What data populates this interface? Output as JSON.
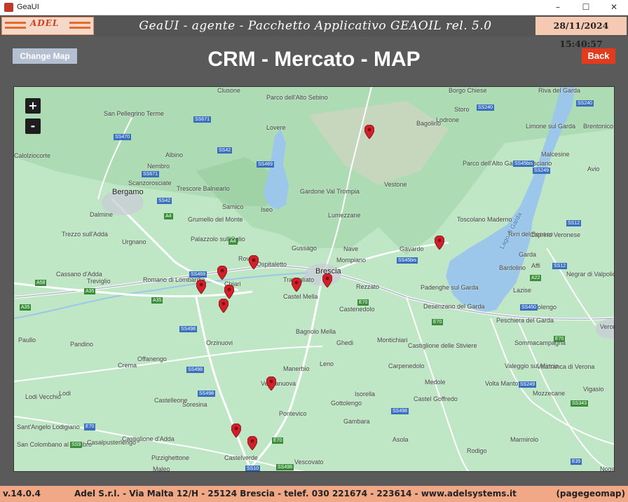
{
  "window": {
    "title": "GeaUI",
    "controls": [
      "–",
      "☐",
      "✕"
    ]
  },
  "header": {
    "logo_text": "ADEL",
    "app_title": "GeaUI - agente - Pacchetto Applicativo GEAOIL rel. 5.0",
    "datetime": "28/11/2024 15:40:57"
  },
  "page": {
    "change_map_label": "Change Map",
    "title": "CRM - Mercato - MAP",
    "back_label": "Back"
  },
  "map": {
    "zoom_in": "+",
    "zoom_out": "-",
    "lake_label": "Lago di Garda",
    "places": [
      {
        "name": "Clusone",
        "big": false
      },
      {
        "name": "Parco dell'Alto Sebino",
        "big": false
      },
      {
        "name": "Borgo Chiese",
        "big": false
      },
      {
        "name": "Riva del Garda",
        "big": false
      },
      {
        "name": "San Pellegrino Terme",
        "big": false
      },
      {
        "name": "Storo",
        "big": false
      },
      {
        "name": "Lovere",
        "big": false
      },
      {
        "name": "Bagolino",
        "big": false
      },
      {
        "name": "Lodrone",
        "big": false
      },
      {
        "name": "Limone sul Garda",
        "big": false
      },
      {
        "name": "Brentonico",
        "big": false
      },
      {
        "name": "Calolziocorte",
        "big": false
      },
      {
        "name": "Albino",
        "big": false
      },
      {
        "name": "Malcesine",
        "big": false
      },
      {
        "name": "Nembro",
        "big": false
      },
      {
        "name": "Parco dell'Alto Garda Bresciano",
        "big": false
      },
      {
        "name": "Avio",
        "big": false
      },
      {
        "name": "Scanzorosciate",
        "big": false
      },
      {
        "name": "Bergamo",
        "big": true
      },
      {
        "name": "Trescore Balneario",
        "big": false
      },
      {
        "name": "Gardone Val Trompia",
        "big": false
      },
      {
        "name": "Vestone",
        "big": false
      },
      {
        "name": "Sarnico",
        "big": false
      },
      {
        "name": "Iseo",
        "big": false
      },
      {
        "name": "Dalmine",
        "big": false
      },
      {
        "name": "Grumello del Monte",
        "big": false
      },
      {
        "name": "Lumezzane",
        "big": false
      },
      {
        "name": "Toscolano Maderno",
        "big": false
      },
      {
        "name": "Trezzo sull'Adda",
        "big": false
      },
      {
        "name": "Urgnano",
        "big": false
      },
      {
        "name": "Palazzolo sull'Oglio",
        "big": false
      },
      {
        "name": "Torri del Benaco",
        "big": false
      },
      {
        "name": "Caprino Veronese",
        "big": false
      },
      {
        "name": "Gussago",
        "big": false
      },
      {
        "name": "Nave",
        "big": false
      },
      {
        "name": "Gavardo",
        "big": false
      },
      {
        "name": "Garda",
        "big": false
      },
      {
        "name": "Mompiano",
        "big": false
      },
      {
        "name": "Rovato",
        "big": false
      },
      {
        "name": "Ospitaletto",
        "big": false
      },
      {
        "name": "Brescia",
        "big": true
      },
      {
        "name": "Bardolino",
        "big": false
      },
      {
        "name": "Affi",
        "big": false
      },
      {
        "name": "Cassano d'Adda",
        "big": false
      },
      {
        "name": "Treviglio",
        "big": false
      },
      {
        "name": "Romano di Lombardia",
        "big": false
      },
      {
        "name": "Chiari",
        "big": false
      },
      {
        "name": "Travagliato",
        "big": false
      },
      {
        "name": "Rezzato",
        "big": false
      },
      {
        "name": "Padenghe sul Garda",
        "big": false
      },
      {
        "name": "Lazise",
        "big": false
      },
      {
        "name": "Negrar di Valpolicella",
        "big": false
      },
      {
        "name": "Castel Mella",
        "big": false
      },
      {
        "name": "Castenedolo",
        "big": false
      },
      {
        "name": "Desenzano del Garda",
        "big": false
      },
      {
        "name": "Bussolengo",
        "big": false
      },
      {
        "name": "Bagnolo Mella",
        "big": false
      },
      {
        "name": "Peschiera del Garda",
        "big": false
      },
      {
        "name": "Verona",
        "big": false
      },
      {
        "name": "Paullo",
        "big": false
      },
      {
        "name": "Pandino",
        "big": false
      },
      {
        "name": "Orzinuovi",
        "big": false
      },
      {
        "name": "Montichiari",
        "big": false
      },
      {
        "name": "Ghedi",
        "big": false
      },
      {
        "name": "Castiglione delle Stiviere",
        "big": false
      },
      {
        "name": "Sommacampagna",
        "big": false
      },
      {
        "name": "Offanengo",
        "big": false
      },
      {
        "name": "Crema",
        "big": false
      },
      {
        "name": "Leno",
        "big": false
      },
      {
        "name": "Carpenedolo",
        "big": false
      },
      {
        "name": "Valeggio sul Mincio",
        "big": false
      },
      {
        "name": "Villafranca di Verona",
        "big": false
      },
      {
        "name": "Manerbio",
        "big": false
      },
      {
        "name": "Verolanuova",
        "big": false
      },
      {
        "name": "Medole",
        "big": false
      },
      {
        "name": "Volta Mantovana",
        "big": false
      },
      {
        "name": "Vigasio",
        "big": false
      },
      {
        "name": "Lodi Vecchio",
        "big": false
      },
      {
        "name": "Lodi",
        "big": false
      },
      {
        "name": "Castelleone",
        "big": false
      },
      {
        "name": "Soresina",
        "big": false
      },
      {
        "name": "Isorella",
        "big": false
      },
      {
        "name": "Gottolengo",
        "big": false
      },
      {
        "name": "Castel Goffredo",
        "big": false
      },
      {
        "name": "Mozzecane",
        "big": false
      },
      {
        "name": "Pontevico",
        "big": false
      },
      {
        "name": "Sant'Angelo Lodigiano",
        "big": false
      },
      {
        "name": "Gambara",
        "big": false
      },
      {
        "name": "Castiglione d'Adda",
        "big": false
      },
      {
        "name": "Asola",
        "big": false
      },
      {
        "name": "Marmirolo",
        "big": false
      },
      {
        "name": "San Colombano al Lambro",
        "big": false
      },
      {
        "name": "Casalpusterlengo",
        "big": false
      },
      {
        "name": "Pizzighettone",
        "big": false
      },
      {
        "name": "Rodigo",
        "big": false
      },
      {
        "name": "Castelverde",
        "big": false
      },
      {
        "name": "Vescovato",
        "big": false
      },
      {
        "name": "Maleo",
        "big": false
      },
      {
        "name": "Nogara",
        "big": false
      }
    ],
    "roads": [
      "SS240",
      "SS671",
      "SS470",
      "SS42",
      "SS469",
      "SS671",
      "SS240",
      "SS45bis",
      "SS249",
      "SS42",
      "A4",
      "SS12",
      "SS469",
      "A4",
      "SS45bis",
      "SS12",
      "A35",
      "A35",
      "A35",
      "A58",
      "A22",
      "SS450",
      "E70",
      "E70",
      "E70",
      "SS498",
      "SS498",
      "E70",
      "SS498",
      "SS249",
      "SS498",
      "SS343",
      "E45",
      "SS9",
      "E35",
      "SS10",
      "SS498",
      "E70"
    ],
    "marker_count": 12
  },
  "footer": {
    "version": "v.14.0.4",
    "company": "Adel S.r.l. - Via Malta 12/H - 25124 Brescia - telef. 030 221674 - 223614 - www.adelsystems.it",
    "page_id": "(pagegeomap)"
  },
  "colors": {
    "background": "#5a5a5a",
    "accent": "#e33b1c",
    "footer": "#f0a886",
    "map_land": "#bfe6c5",
    "water": "#9cc7ea",
    "marker": "#d0202a"
  }
}
